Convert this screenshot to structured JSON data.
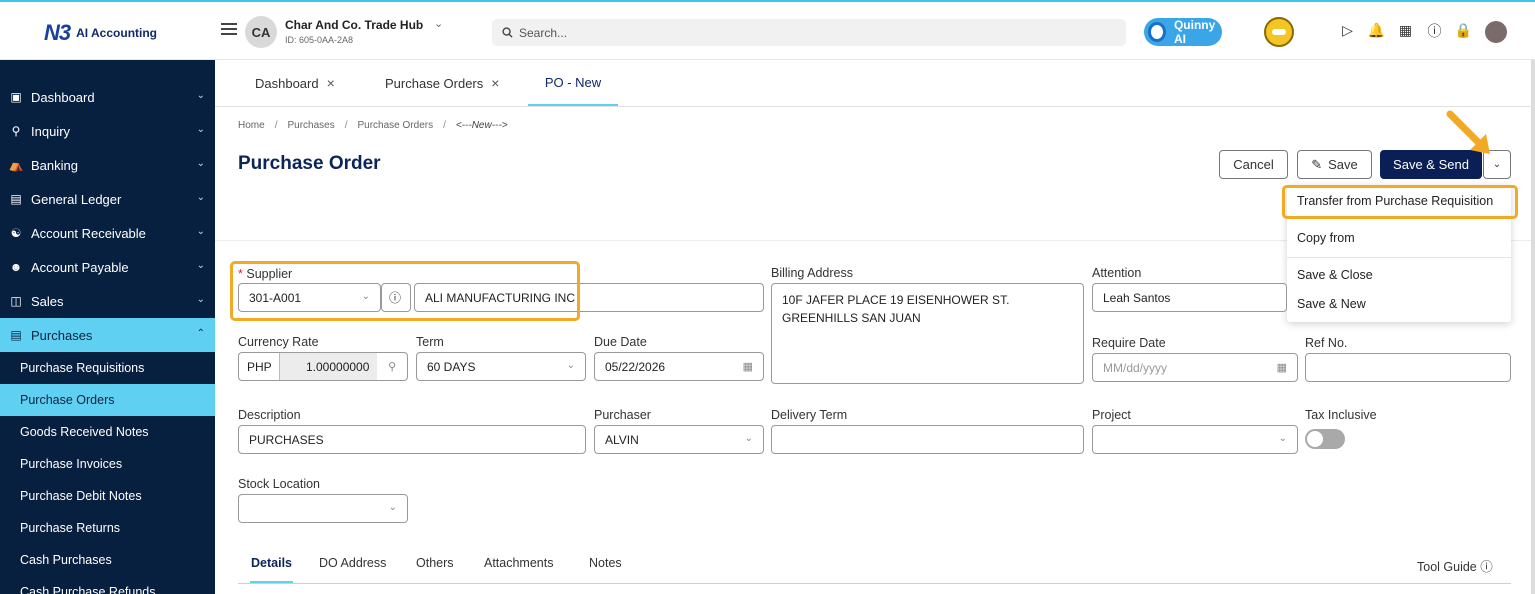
{
  "app": {
    "logo_mark": "N3",
    "logo_text": "AI Accounting"
  },
  "company": {
    "initials": "CA",
    "name": "Char And Co. Trade Hub",
    "id": "ID: 605-0AA-2A8"
  },
  "search": {
    "placeholder": "Search..."
  },
  "assistant": {
    "label": "Quinny AI"
  },
  "sidebar": {
    "items": [
      {
        "label": "Dashboard",
        "icon": "dashboard-icon"
      },
      {
        "label": "Inquiry",
        "icon": "inquiry-icon"
      },
      {
        "label": "Banking",
        "icon": "bank-icon"
      },
      {
        "label": "General Ledger",
        "icon": "ledger-icon"
      },
      {
        "label": "Account Receivable",
        "icon": "receivable-icon"
      },
      {
        "label": "Account Payable",
        "icon": "payable-icon"
      },
      {
        "label": "Sales",
        "icon": "sales-icon"
      },
      {
        "label": "Purchases",
        "icon": "purchases-icon"
      }
    ],
    "subitems": [
      "Purchase Requisitions",
      "Purchase Orders",
      "Goods Received Notes",
      "Purchase Invoices",
      "Purchase Debit Notes",
      "Purchase Returns",
      "Cash Purchases",
      "Cash Purchase Refunds"
    ]
  },
  "tabs": [
    {
      "label": "Dashboard"
    },
    {
      "label": "Purchase Orders"
    },
    {
      "label": "PO - New"
    }
  ],
  "breadcrumb": [
    "Home",
    "Purchases",
    "Purchase Orders",
    "<---New--->"
  ],
  "page": {
    "title": "Purchase Order",
    "cancel_label": "Cancel",
    "save_label": "Save",
    "save_send_label": "Save & Send"
  },
  "dropdown": {
    "items": [
      "Transfer from Purchase Requisition",
      "Copy from",
      "Save & Close",
      "Save & New"
    ]
  },
  "form": {
    "supplier_label": "Supplier",
    "supplier_code": "301-A001",
    "supplier_name": "ALI MANUFACTURING INC",
    "billing_label": "Billing Address",
    "billing_line1": "10F JAFER PLACE 19 EISENHOWER ST.",
    "billing_line2": "GREENHILLS SAN JUAN",
    "attention_label": "Attention",
    "attention_value": "Leah Santos",
    "currency_label": "Currency Rate",
    "currency_code": "PHP",
    "currency_rate": "1.00000000",
    "term_label": "Term",
    "term_value": "60 DAYS",
    "due_label": "Due Date",
    "due_value": "05/22/2026",
    "require_label": "Require Date",
    "require_placeholder": "MM/dd/yyyy",
    "ref_label": "Ref No.",
    "description_label": "Description",
    "description_value": "PURCHASES",
    "purchaser_label": "Purchaser",
    "purchaser_value": "ALVIN",
    "delivery_label": "Delivery Term",
    "project_label": "Project",
    "tax_label": "Tax Inclusive",
    "tax_inclusive": false,
    "stock_label": "Stock Location"
  },
  "bottom_tabs": [
    "Details",
    "DO Address",
    "Others",
    "Attachments",
    "Notes"
  ],
  "tool_guide": "Tool Guide",
  "colors": {
    "sidebar_bg": "#072040",
    "accent": "#5fd0f2",
    "primary_button": "#0a1f55",
    "highlight": "#f2a925"
  }
}
